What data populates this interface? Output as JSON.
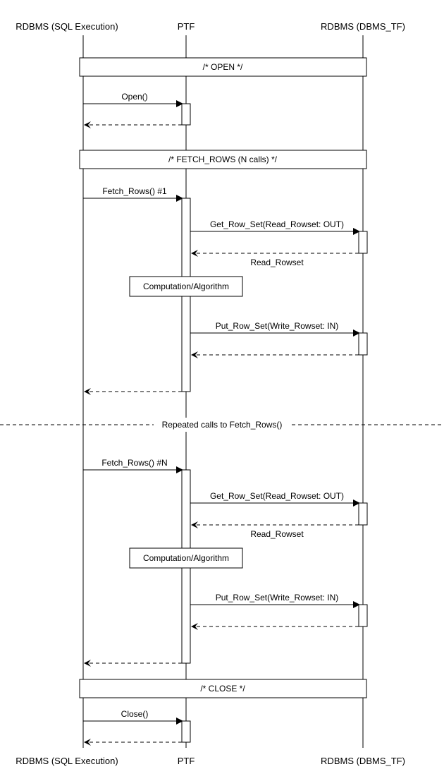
{
  "participants": {
    "left": "RDBMS (SQL Execution)",
    "mid": "PTF",
    "right": "RDBMS (DBMS_TF)"
  },
  "phases": {
    "open": "/* OPEN */",
    "fetch": "/* FETCH_ROWS (N calls) */",
    "close": "/* CLOSE */"
  },
  "messages": {
    "open_call": "Open()",
    "fetch1": "Fetch_Rows() #1",
    "get_row_set": "Get_Row_Set(Read_Rowset: OUT)",
    "read_rowset": "Read_Rowset",
    "comp": "Computation/Algorithm",
    "put_row_set": "Put_Row_Set(Write_Rowset: IN)",
    "repeat_divider": "Repeated calls to Fetch_Rows()",
    "fetchN": "Fetch_Rows() #N",
    "close_call": "Close()"
  }
}
